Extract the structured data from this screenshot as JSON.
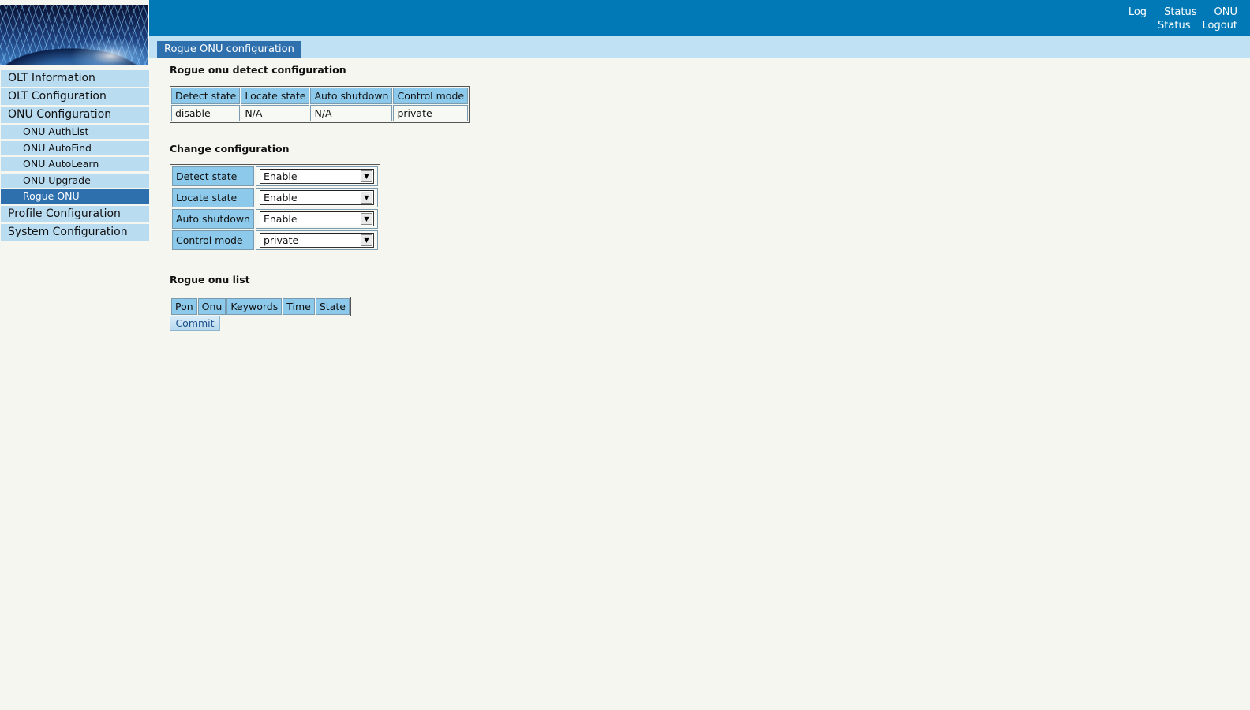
{
  "header": {
    "links_row1": [
      "Log",
      "Status",
      "ONU"
    ],
    "links_row2": [
      "Status",
      "Logout"
    ],
    "tab_label": "Rogue ONU configuration"
  },
  "sidebar": {
    "items": [
      {
        "label": "OLT Information",
        "level": "main"
      },
      {
        "label": "OLT Configuration",
        "level": "main"
      },
      {
        "label": "ONU Configuration",
        "level": "main"
      },
      {
        "label": "ONU AuthList",
        "level": "sub"
      },
      {
        "label": "ONU AutoFind",
        "level": "sub"
      },
      {
        "label": "ONU AutoLearn",
        "level": "sub"
      },
      {
        "label": "ONU Upgrade",
        "level": "sub"
      },
      {
        "label": "Rogue ONU",
        "level": "sub",
        "active": true
      },
      {
        "label": "Profile Configuration",
        "level": "main"
      },
      {
        "label": "System Configuration",
        "level": "main"
      }
    ]
  },
  "detect": {
    "title": "Rogue onu detect configuration",
    "headers": [
      "Detect state",
      "Locate state",
      "Auto shutdown",
      "Control mode"
    ],
    "values": [
      "disable",
      "N/A",
      "N/A",
      "private"
    ]
  },
  "change": {
    "title": "Change configuration",
    "rows": [
      {
        "label": "Detect state",
        "value": "Enable"
      },
      {
        "label": "Locate state",
        "value": "Enable"
      },
      {
        "label": "Auto shutdown",
        "value": "Enable"
      },
      {
        "label": "Control mode",
        "value": "private"
      }
    ]
  },
  "rogue_list": {
    "title": "Rogue onu list",
    "headers": [
      "Pon",
      "Onu",
      "Keywords",
      "Time",
      "State"
    ]
  },
  "commit_label": "Commit"
}
